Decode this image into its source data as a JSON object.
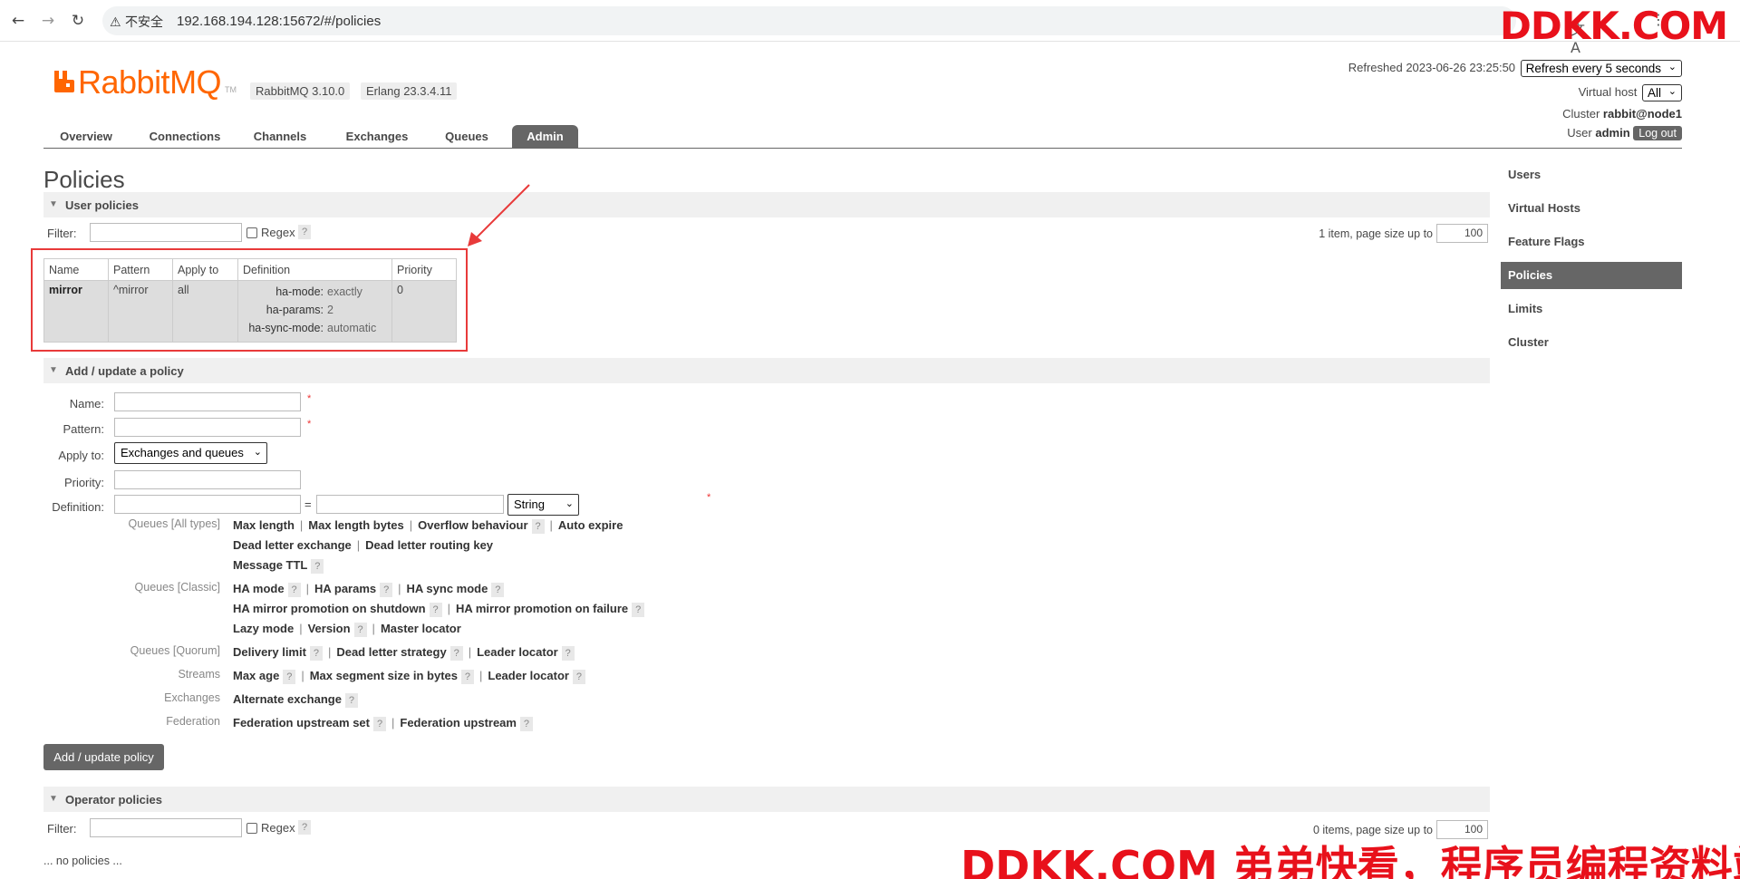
{
  "browser": {
    "security_label": "⚠ 不安全",
    "url": "192.168.194.128:15672/#/policies",
    "translate_icon": "translate-icon"
  },
  "watermark": {
    "top": "DDKK.COM",
    "bottom": "DDKK.COM 弟弟快看，程序员编程资料站"
  },
  "header": {
    "logo_text": "RabbitMQ",
    "logo_tm": "TM",
    "rabbitmq_version": "RabbitMQ 3.10.0",
    "erlang_version": "Erlang 23.3.4.11",
    "refreshed_label": "Refreshed 2023-06-26 23:25:50",
    "refresh_select": "Refresh every 5 seconds",
    "vhost_label": "Virtual host",
    "vhost_select": "All",
    "cluster_label": "Cluster",
    "cluster_value": "rabbit@node1",
    "user_label": "User",
    "user_value": "admin",
    "logout_label": "Log out"
  },
  "tabs": [
    {
      "label": "Overview"
    },
    {
      "label": "Connections"
    },
    {
      "label": "Channels"
    },
    {
      "label": "Exchanges"
    },
    {
      "label": "Queues"
    },
    {
      "label": "Admin",
      "active": true
    }
  ],
  "page_title": "Policies",
  "user_policies": {
    "title": "User policies",
    "filter_label": "Filter:",
    "regex_label": "Regex",
    "help": "?",
    "page_info": "1 item, page size up to",
    "page_size": "100",
    "columns": [
      "Name",
      "Pattern",
      "Apply to",
      "Definition",
      "Priority"
    ],
    "rows": [
      {
        "name": "mirror",
        "pattern": "^mirror",
        "apply_to": "all",
        "definition": [
          {
            "key": "ha-mode:",
            "value": "exactly"
          },
          {
            "key": "ha-params:",
            "value": "2"
          },
          {
            "key": "ha-sync-mode:",
            "value": "automatic"
          }
        ],
        "priority": "0"
      }
    ]
  },
  "add_policy": {
    "title": "Add / update a policy",
    "name_label": "Name:",
    "pattern_label": "Pattern:",
    "apply_to_label": "Apply to:",
    "apply_to_value": "Exchanges and queues",
    "priority_label": "Priority:",
    "definition_label": "Definition:",
    "equals": "=",
    "type_value": "String",
    "required": "*",
    "categories": {
      "queues_all": "Queues [All types]",
      "queues_classic": "Queues [Classic]",
      "queues_quorum": "Queues [Quorum]",
      "streams": "Streams",
      "exchanges": "Exchanges",
      "federation": "Federation"
    },
    "args": {
      "max_length": "Max length",
      "max_length_bytes": "Max length bytes",
      "overflow_behaviour": "Overflow behaviour",
      "auto_expire": "Auto expire",
      "dead_letter_exchange": "Dead letter exchange",
      "dead_letter_routing_key": "Dead letter routing key",
      "message_ttl": "Message TTL",
      "ha_mode": "HA mode",
      "ha_params": "HA params",
      "ha_sync_mode": "HA sync mode",
      "ha_promo_shutdown": "HA mirror promotion on shutdown",
      "ha_promo_failure": "HA mirror promotion on failure",
      "lazy_mode": "Lazy mode",
      "version": "Version",
      "master_locator": "Master locator",
      "delivery_limit": "Delivery limit",
      "dead_letter_strategy": "Dead letter strategy",
      "leader_locator": "Leader locator",
      "max_age": "Max age",
      "max_segment_size": "Max segment size in bytes",
      "alternate_exchange": "Alternate exchange",
      "federation_upstream_set": "Federation upstream set",
      "federation_upstream": "Federation upstream"
    },
    "separator": "|",
    "submit_label": "Add / update policy"
  },
  "operator_policies": {
    "title": "Operator policies",
    "filter_label": "Filter:",
    "regex_label": "Regex",
    "page_info": "0 items, page size up to",
    "page_size": "100",
    "empty_text": "... no policies ..."
  },
  "sidebar": {
    "items": [
      {
        "label": "Users"
      },
      {
        "label": "Virtual Hosts"
      },
      {
        "label": "Feature Flags"
      },
      {
        "label": "Policies",
        "active": true
      },
      {
        "label": "Limits"
      },
      {
        "label": "Cluster"
      }
    ]
  },
  "colors": {
    "brand": "#ff6600",
    "active_tab": "#666666",
    "highlight": "#e83a3a",
    "watermark": "#e8111b"
  }
}
